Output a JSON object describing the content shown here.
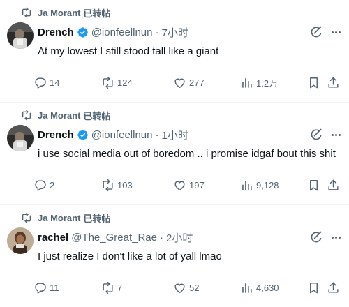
{
  "tweets": [
    {
      "retweeter": "Ja Morant",
      "retweet_label": "已转帖",
      "name": "Drench",
      "verified": true,
      "handle": "@ionfeellnun",
      "separator": "·",
      "time": "7小时",
      "text": "At my lowest I still stood tall like a giant",
      "replies": "14",
      "retweets": "124",
      "likes": "277",
      "views": "1.2万"
    },
    {
      "retweeter": "Ja Morant",
      "retweet_label": "已转帖",
      "name": "Drench",
      "verified": true,
      "handle": "@ionfeellnun",
      "separator": "·",
      "time": "1小时",
      "text": "i use social media out of boredom .. i promise idgaf bout this shit",
      "replies": "2",
      "retweets": "103",
      "likes": "197",
      "views": "9,128"
    },
    {
      "retweeter": "Ja Morant",
      "retweet_label": "已转帖",
      "name": "rachel",
      "verified": false,
      "handle": "@The_Great_Rae",
      "separator": "·",
      "time": "2小时",
      "text": "I just realize I don't like a lot of yall lmao",
      "replies": "11",
      "retweets": "7",
      "likes": "52",
      "views": "4,630"
    }
  ],
  "colors": {
    "text_primary": "#0f1419",
    "text_secondary": "#536471",
    "verified_blue": "#1d9bf0",
    "divider": "#eff3f4"
  },
  "icons": [
    "retweet-icon",
    "verified-badge-icon",
    "grok-icon",
    "more-icon",
    "reply-icon",
    "like-icon",
    "views-icon",
    "bookmark-icon",
    "share-icon"
  ]
}
